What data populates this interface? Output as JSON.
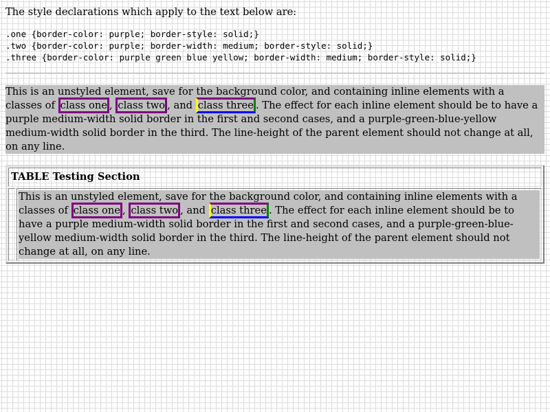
{
  "intro": "The style declarations which apply to the text below are:",
  "styles": [
    ".one {border-color: purple; border-style: solid;}",
    ".two {border-color: purple; border-width: medium; border-style: solid;}",
    ".three {border-color: purple green blue yellow; border-width: medium; border-style: solid;}"
  ],
  "paragraph": {
    "before": "This is an unstyled element, save for the background color, and containing inline elements with a classes of ",
    "class_one": "class one",
    "sep1": ", ",
    "class_two": "class two",
    "sep2": ", and ",
    "class_three": "class three",
    "after": ". The effect for each inline element should be to have a purple medium-width solid border in the first and second cases, and a purple-green-blue-yellow medium-width solid border in the third. The line-height of the parent element should not change at all, on any line."
  },
  "table": {
    "header": "TABLE Testing Section"
  }
}
